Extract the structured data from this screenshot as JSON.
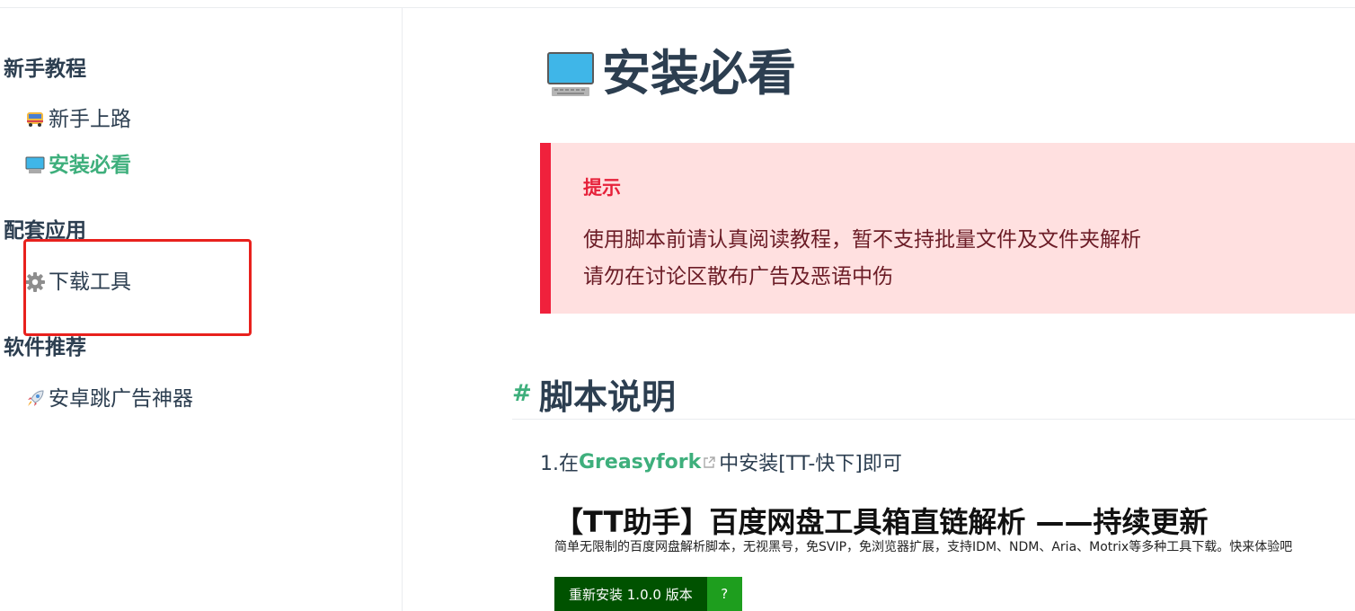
{
  "sidebar": {
    "groups": [
      {
        "title": "新手教程",
        "items": [
          {
            "label": "新手上路",
            "icon": "bus-icon"
          },
          {
            "label": "安装必看",
            "icon": "computer-icon",
            "active": true
          }
        ]
      },
      {
        "title": "配套应用",
        "items": [
          {
            "label": "下载工具",
            "icon": "gear-icon"
          }
        ]
      },
      {
        "title": "软件推荐",
        "items": [
          {
            "label": "安卓跳广告神器",
            "icon": "rocket-icon"
          }
        ]
      }
    ]
  },
  "page": {
    "title": "安装必看",
    "tip": {
      "title": "提示",
      "lines": [
        "使用脚本前请认真阅读教程，暂不支持批量文件及文件夹解析",
        "请勿在讨论区散布广告及恶语中伤"
      ]
    },
    "section": {
      "anchor": "#",
      "heading": "脚本说明",
      "para_prefix": "1.在",
      "link": "Greasyfork",
      "para_suffix": "中安装[TT-快下]即可"
    },
    "card": {
      "title": "【TT助手】百度网盘工具箱直链解析 ——持续更新",
      "desc": "简单无限制的百度网盘解析脚本，无视黑号，免SVIP，免浏览器扩展，支持IDM、NDM、Aria、Motrix等多种工具下载。快来体验吧",
      "install_label": "重新安装 1.0.0 版本",
      "help_label": "?"
    }
  },
  "colors": {
    "accent": "#3eaf7c",
    "tip_border": "#f0213c",
    "tip_bg": "#ffe0e0",
    "highlight_box": "#e8211d",
    "install_dark": "#005200",
    "install_light": "#1e9e1e"
  }
}
